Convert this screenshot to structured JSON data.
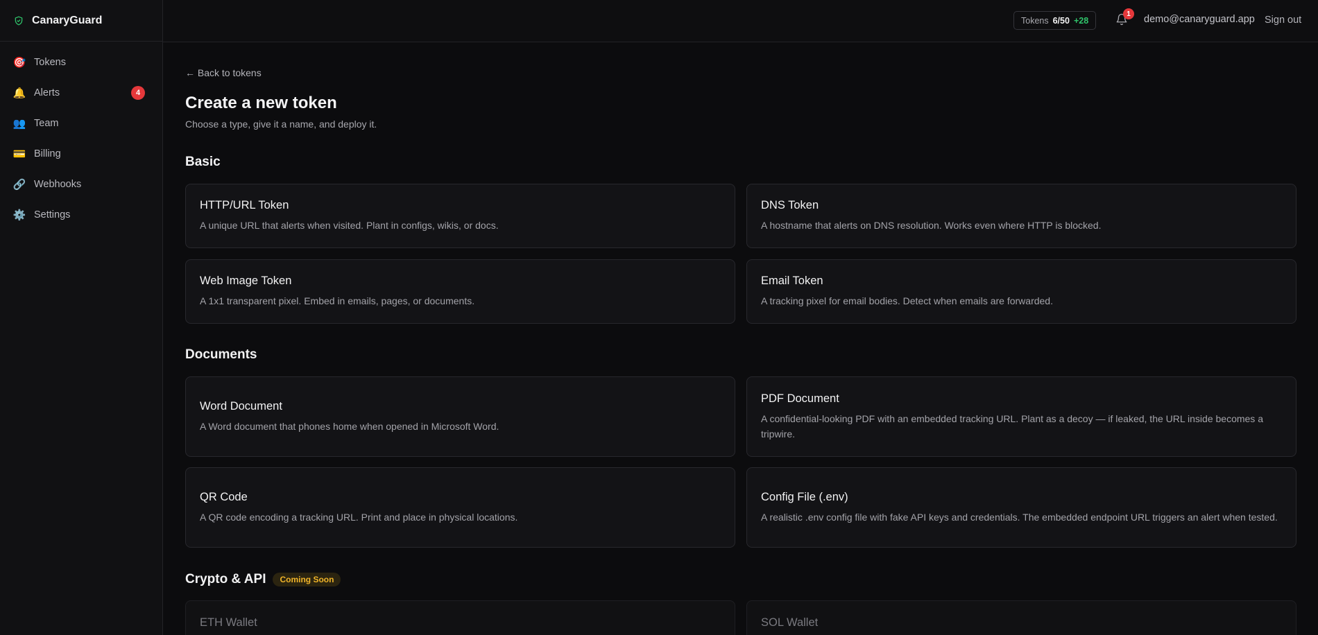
{
  "app": {
    "name": "CanaryGuard"
  },
  "sidebar": {
    "items": [
      {
        "label": "Tokens",
        "icon": "dart-icon"
      },
      {
        "label": "Alerts",
        "icon": "bell-icon",
        "badge": "4"
      },
      {
        "label": "Team",
        "icon": "people-icon"
      },
      {
        "label": "Billing",
        "icon": "credit-card-icon"
      },
      {
        "label": "Webhooks",
        "icon": "link-icon"
      },
      {
        "label": "Settings",
        "icon": "gear-icon"
      }
    ]
  },
  "topbar": {
    "usage_label": "Tokens",
    "usage_count": "6/50",
    "usage_extra": "+28",
    "notifications_count": "1",
    "user_email": "demo@canaryguard.app",
    "signout_label": "Sign out"
  },
  "main": {
    "back_label": "← Back to tokens",
    "title": "Create a new token",
    "subtitle": "Choose a type, give it a name, and deploy it.",
    "sections": [
      {
        "title": "Basic",
        "cards": [
          {
            "title": "HTTP/URL Token",
            "desc": "A unique URL that alerts when visited. Plant in configs, wikis, or docs."
          },
          {
            "title": "DNS Token",
            "desc": "A hostname that alerts on DNS resolution. Works even where HTTP is blocked."
          },
          {
            "title": "Web Image Token",
            "desc": "A 1x1 transparent pixel. Embed in emails, pages, or documents."
          },
          {
            "title": "Email Token",
            "desc": "A tracking pixel for email bodies. Detect when emails are forwarded."
          }
        ]
      },
      {
        "title": "Documents",
        "cards": [
          {
            "title": "Word Document",
            "desc": "A Word document that phones home when opened in Microsoft Word."
          },
          {
            "title": "PDF Document",
            "desc": "A confidential-looking PDF with an embedded tracking URL. Plant as a decoy — if leaked, the URL inside becomes a tripwire."
          },
          {
            "title": "QR Code",
            "desc": "A QR code encoding a tracking URL. Print and place in physical locations."
          },
          {
            "title": "Config File (.env)",
            "desc": "A realistic .env config file with fake API keys and credentials. The embedded endpoint URL triggers an alert when tested."
          }
        ]
      },
      {
        "title": "Crypto & API",
        "badge": "Coming Soon",
        "cards": [
          {
            "title": "ETH Wallet"
          },
          {
            "title": "SOL Wallet"
          }
        ]
      }
    ]
  },
  "colors": {
    "accent_green": "#2fc46b",
    "alert_red": "#e5383b",
    "coming_soon": "#f0b429"
  }
}
